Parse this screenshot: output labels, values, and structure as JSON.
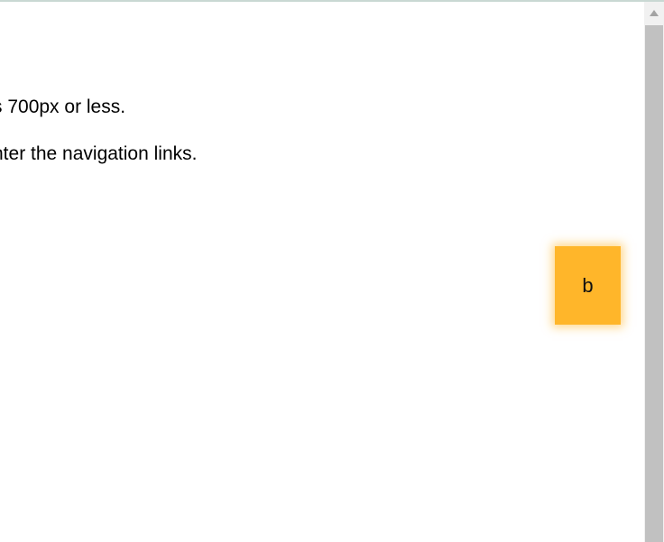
{
  "content": {
    "line1": "s 700px or less.",
    "line2": "nter the navigation links.",
    "box_label": "b"
  },
  "colors": {
    "box": "#ffb62a",
    "scrollbar_track": "#f1f1f1",
    "scrollbar_thumb": "#c1c1c1"
  },
  "icons": {
    "scroll_up": "scroll-up-arrow-icon"
  }
}
